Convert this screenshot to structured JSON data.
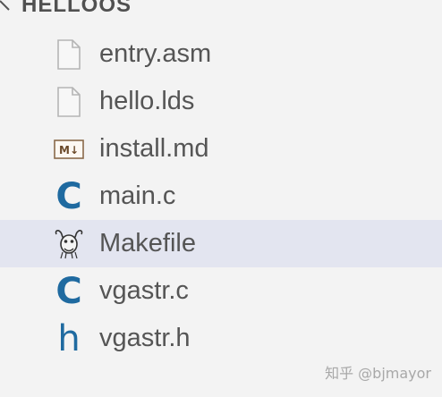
{
  "explorer": {
    "folder_name": "HELLOOS",
    "files": [
      {
        "name": "entry.asm",
        "icon": "file-icon"
      },
      {
        "name": "hello.lds",
        "icon": "file-icon"
      },
      {
        "name": "install.md",
        "icon": "markdown-icon",
        "badge": "M↓"
      },
      {
        "name": "main.c",
        "icon": "c-language-icon",
        "glyph": "C"
      },
      {
        "name": "Makefile",
        "icon": "gnu-makefile-icon",
        "selected": true
      },
      {
        "name": "vgastr.c",
        "icon": "c-language-icon",
        "glyph": "C"
      },
      {
        "name": "vgastr.h",
        "icon": "header-file-icon",
        "glyph": "h"
      }
    ]
  },
  "watermark": "知乎 @bjmayor",
  "colors": {
    "background": "#f3f3f3",
    "selected_row": "#e3e5f0",
    "c_icon": "#1f6aa0",
    "text": "#555555"
  }
}
